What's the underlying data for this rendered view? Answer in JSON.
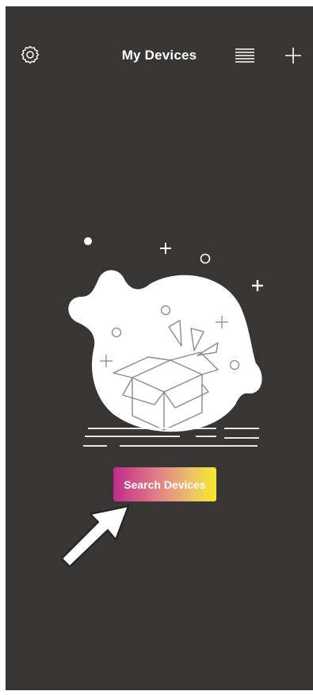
{
  "header": {
    "title": "My Devices",
    "settings_icon": "gear-icon",
    "list_icon": "list-view-icon",
    "add_icon": "plus-icon"
  },
  "empty_state": {
    "illustration": "empty-box-illustration",
    "search_label": "Search Devices",
    "pointer_icon": "arrow-pointer-icon"
  },
  "colors": {
    "background": "#383634",
    "button_gradient_start": "#c02a8c",
    "button_gradient_end": "#f6ea2a"
  }
}
